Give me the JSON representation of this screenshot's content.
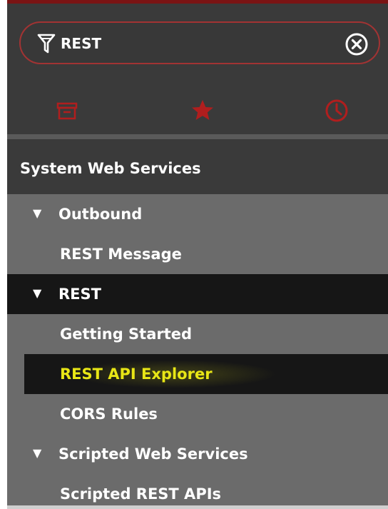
{
  "search": {
    "value": "REST",
    "icon": "filter-icon",
    "clear_icon": "close-circle-icon"
  },
  "tabs": [
    {
      "icon": "archive-icon"
    },
    {
      "icon": "star-icon"
    },
    {
      "icon": "clock-icon"
    }
  ],
  "section": {
    "title": "System Web Services"
  },
  "items": [
    {
      "label": "Outbound",
      "expanded": true
    },
    {
      "label": "REST Message"
    },
    {
      "label": "REST",
      "expanded": true
    },
    {
      "label": "Getting Started"
    },
    {
      "label": "REST API Explorer"
    },
    {
      "label": "CORS Rules"
    },
    {
      "label": "Scripted Web Services",
      "expanded": true
    },
    {
      "label": "Scripted REST APIs"
    }
  ],
  "caret_glyph": "▼",
  "colors": {
    "accent": "#b01e1e",
    "active_text": "#e8e616",
    "panel_bg": "#6b6b6b",
    "header_bg": "#3a3a3a",
    "selected_bg": "#161616"
  }
}
